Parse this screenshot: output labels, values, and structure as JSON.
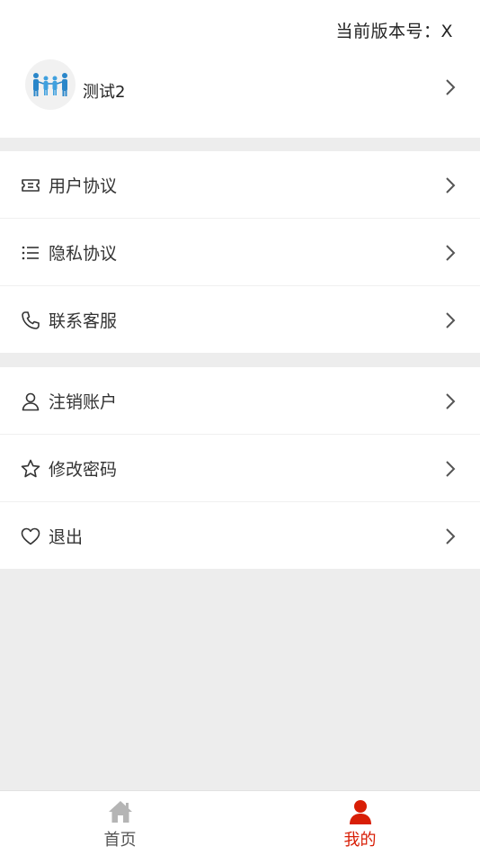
{
  "header": {
    "version_text": "当前版本号：X"
  },
  "profile": {
    "username": "测试2",
    "avatar_icon": "family-people-icon"
  },
  "group1": {
    "items": [
      {
        "label": "用户协议",
        "icon": "ticket-icon"
      },
      {
        "label": "隐私协议",
        "icon": "list-icon"
      },
      {
        "label": "联系客服",
        "icon": "phone-icon"
      }
    ]
  },
  "group2": {
    "items": [
      {
        "label": "注销账户",
        "icon": "user-icon"
      },
      {
        "label": "修改密码",
        "icon": "star-icon"
      },
      {
        "label": "退出",
        "icon": "heart-icon"
      }
    ]
  },
  "tabbar": {
    "tabs": [
      {
        "label": "首页",
        "icon": "home-icon",
        "active": false
      },
      {
        "label": "我的",
        "icon": "person-icon",
        "active": true
      }
    ]
  },
  "colors": {
    "accent": "#d81e06",
    "background": "#ededed",
    "card": "#ffffff",
    "inactive_icon": "#b5b5b5"
  }
}
